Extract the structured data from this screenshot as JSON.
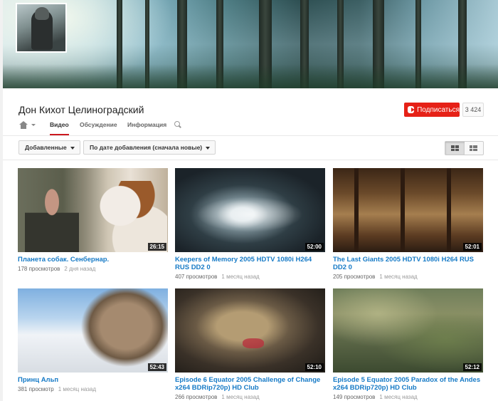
{
  "channel": {
    "name": "Дон Кихот Целиноградский",
    "subscribe_label": "Подписаться",
    "subscriber_count": "3 424"
  },
  "tabs": [
    {
      "label": "Видео",
      "active": true
    },
    {
      "label": "Обсуждение",
      "active": false
    },
    {
      "label": "Информация",
      "active": false
    }
  ],
  "filters": {
    "type_label": "Добавленные",
    "sort_label": "По дате добавления (сначала новые)"
  },
  "icons": {
    "home": "home-icon",
    "search": "search-icon",
    "grid_view": "grid-view-icon",
    "list_view": "list-view-icon"
  },
  "videos": [
    {
      "title": "Планета собак. Сенбернар.",
      "views": "178 просмотров",
      "ago": "2 дня назад",
      "duration": "26:15"
    },
    {
      "title": "Keepers of Memory 2005 HDTV 1080i H264 RUS DD2 0",
      "views": "407 просмотров",
      "ago": "1 месяц назад",
      "duration": "52:00"
    },
    {
      "title": "The Last Giants 2005 HDTV 1080i H264 RUS DD2 0",
      "views": "205 просмотров",
      "ago": "1 месяц назад",
      "duration": "52:01"
    },
    {
      "title": "Принц Альп",
      "views": "381 просмотр",
      "ago": "1 месяц назад",
      "duration": "52:43"
    },
    {
      "title": "Episode 6 Equator 2005 Challenge of Change x264 BDRip720p) HD Club",
      "views": "266 просмотров",
      "ago": "1 месяц назад",
      "duration": "52:10"
    },
    {
      "title": "Episode 5 Equator 2005 Paradox of the Andes x264 BDRip720p) HD Club",
      "views": "149 просмотров",
      "ago": "1 месяц назад",
      "duration": "52:12"
    }
  ],
  "colors": {
    "accent_red": "#e62117",
    "link_blue": "#167ac6"
  }
}
